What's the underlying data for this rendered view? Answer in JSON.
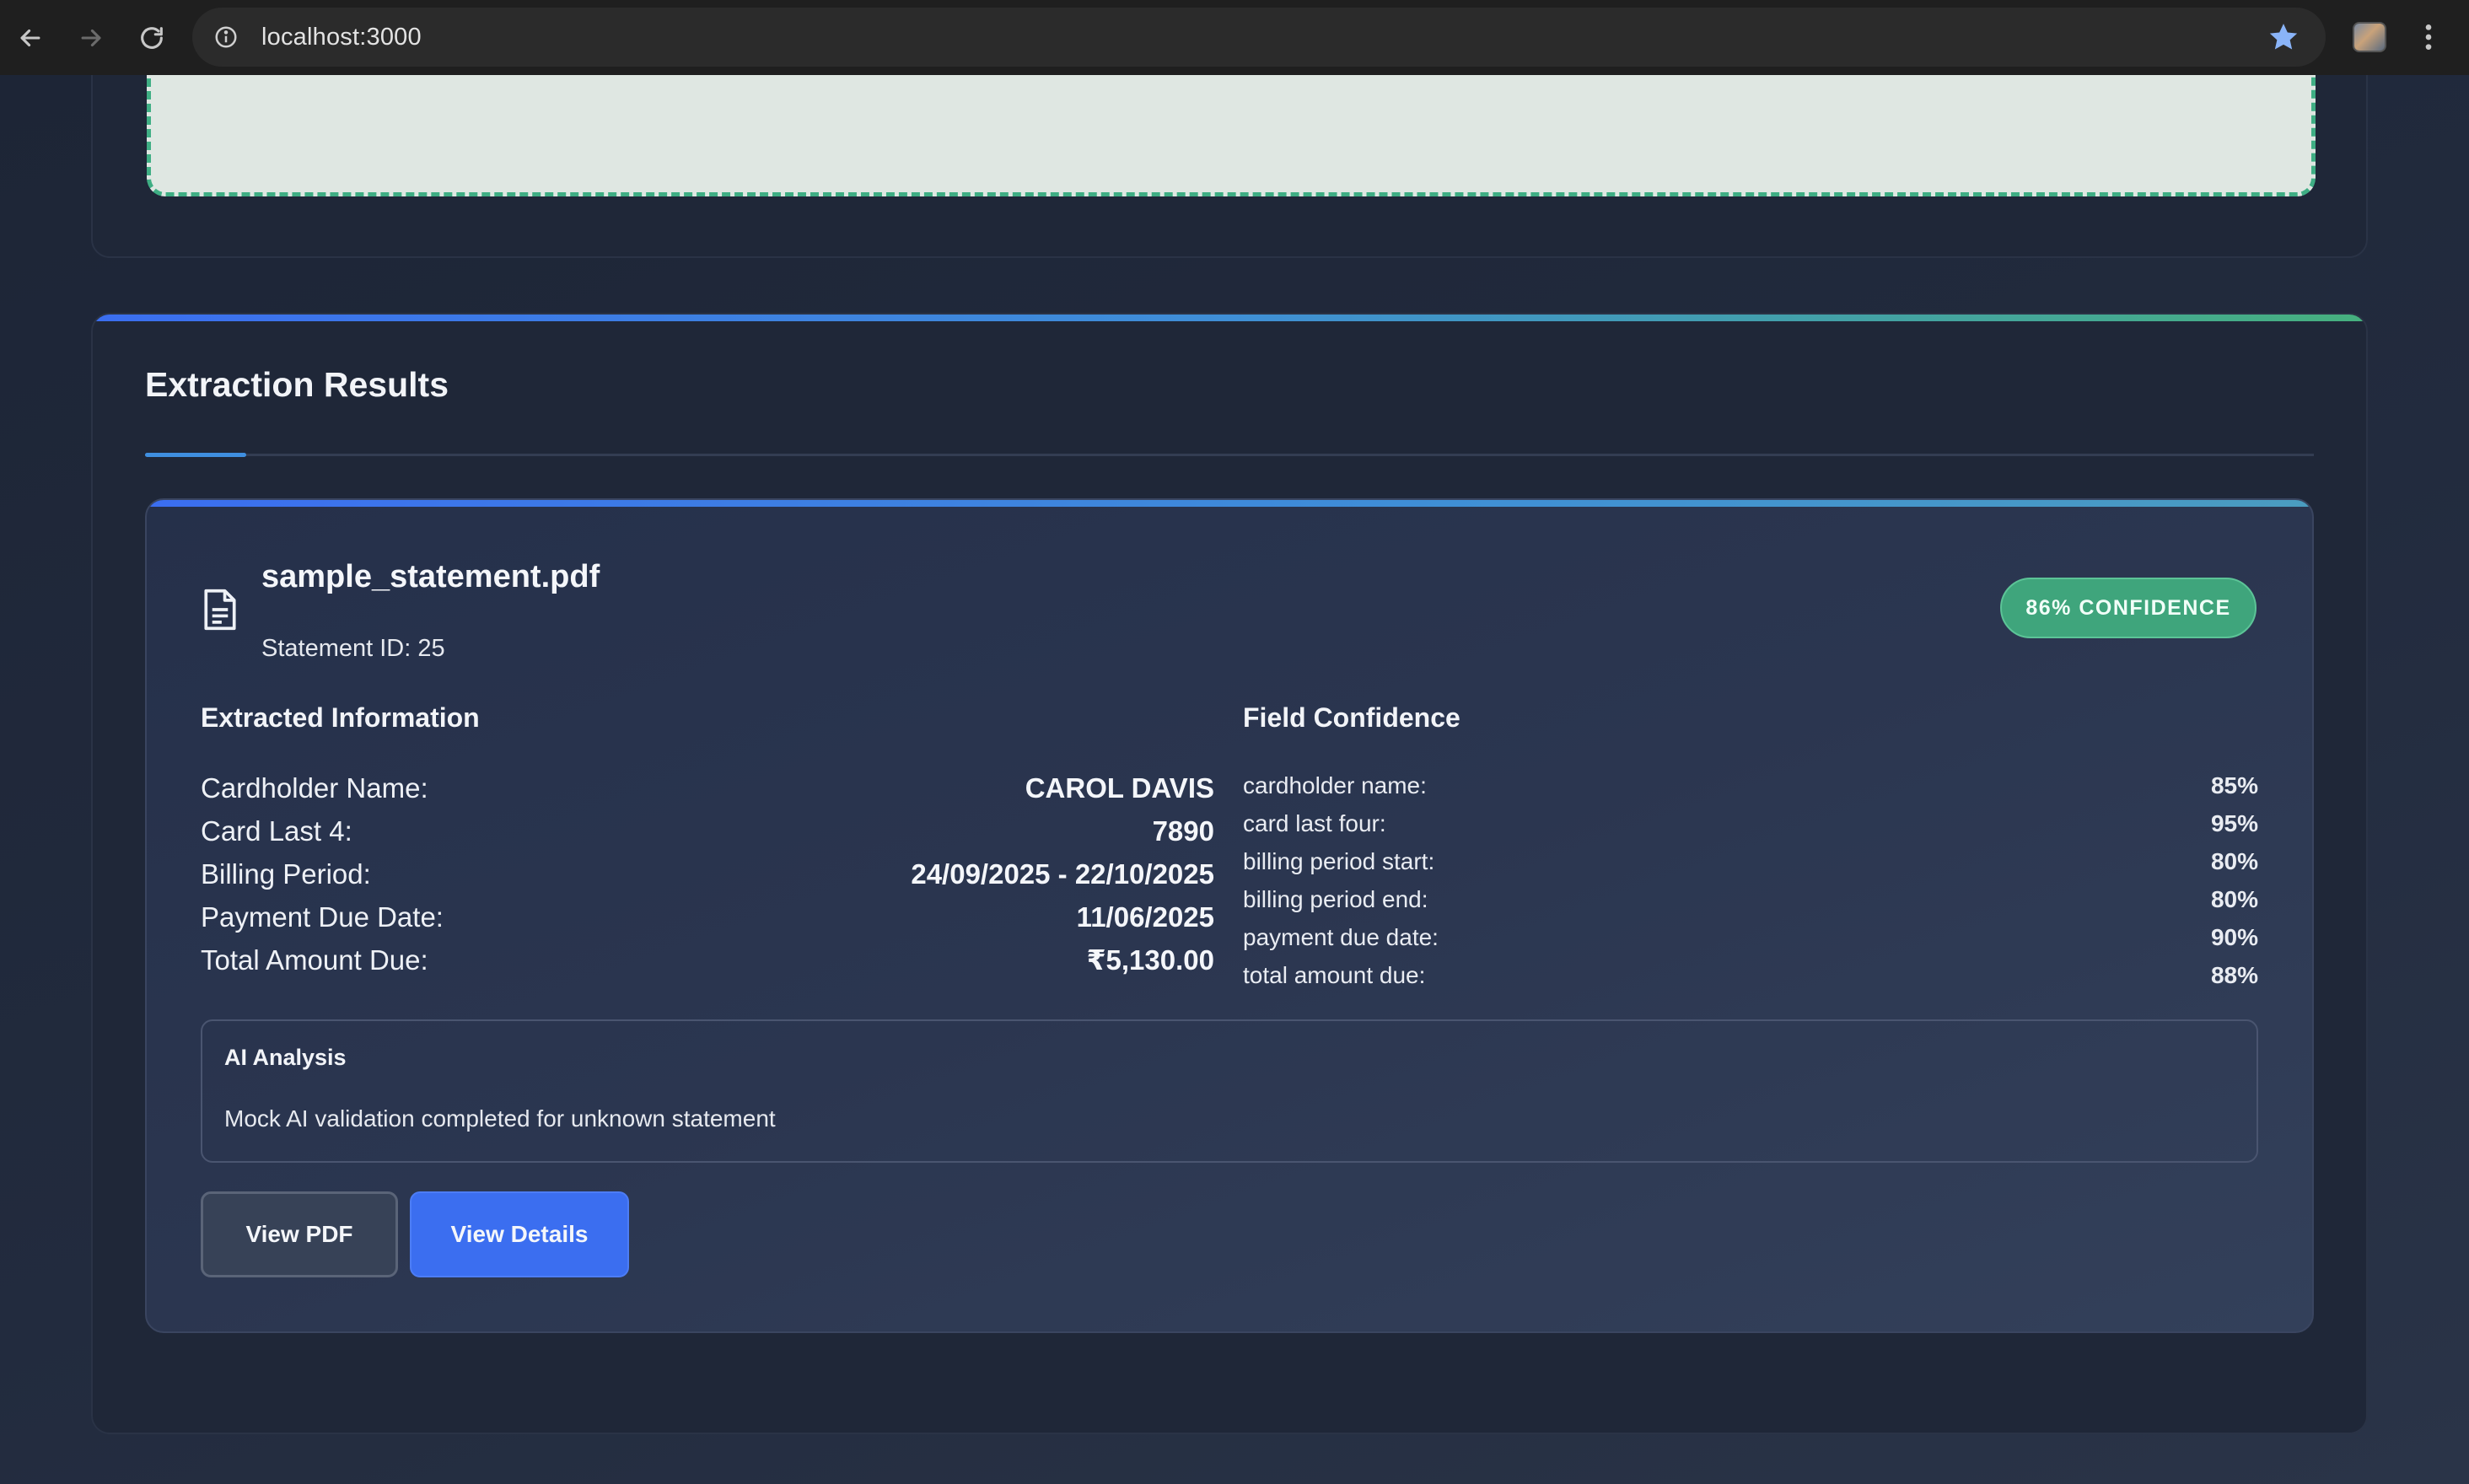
{
  "browser": {
    "url": "localhost:3000"
  },
  "results": {
    "title": "Extraction Results"
  },
  "statement": {
    "file_name": "sample_statement.pdf",
    "statement_id": "Statement ID: 25",
    "confidence_badge": "86% CONFIDENCE",
    "extracted_heading": "Extracted Information",
    "confidence_heading": "Field Confidence",
    "fields": [
      {
        "label": "Cardholder Name:",
        "value": "CAROL DAVIS"
      },
      {
        "label": "Card Last 4:",
        "value": "7890"
      },
      {
        "label": "Billing Period:",
        "value": "24/09/2025 - 22/10/2025"
      },
      {
        "label": "Payment Due Date:",
        "value": "11/06/2025"
      },
      {
        "label": "Total Amount Due:",
        "value": "₹5,130.00"
      }
    ],
    "field_confidence": [
      {
        "label": "cardholder name:",
        "value": "85%"
      },
      {
        "label": "card last four:",
        "value": "95%"
      },
      {
        "label": "billing period start:",
        "value": "80%"
      },
      {
        "label": "billing period end:",
        "value": "80%"
      },
      {
        "label": "payment due date:",
        "value": "90%"
      },
      {
        "label": "total amount due:",
        "value": "88%"
      }
    ],
    "ai_analysis": {
      "title": "AI Analysis",
      "text": "Mock AI validation completed for unknown statement"
    },
    "buttons": {
      "view_pdf": "View PDF",
      "view_details": "View Details"
    }
  },
  "colors": {
    "accent_blue": "#3b6ef0",
    "confidence_green": "#3fa57c",
    "dropzone_border": "#3fae84"
  }
}
